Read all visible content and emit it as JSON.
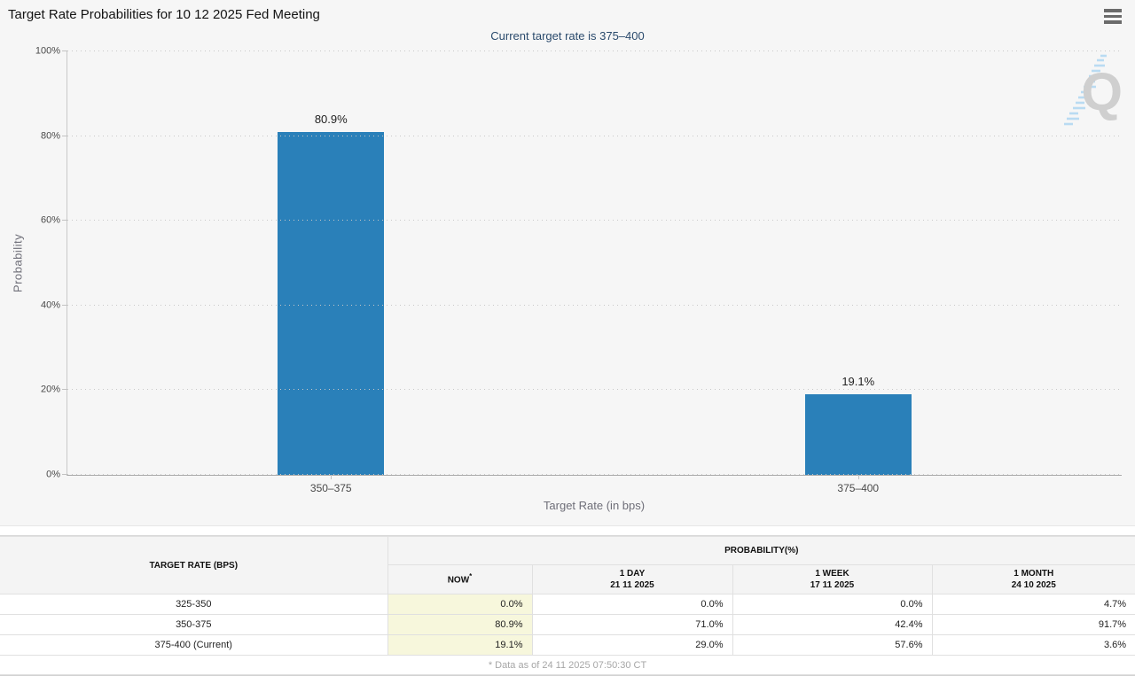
{
  "colors": {
    "bar": "#2a80b9",
    "chart_background": "#f6f6f6",
    "subtitle_text": "#2a4a6c",
    "now_column_background": "#f7f7dc"
  },
  "header": {
    "title": "Target Rate Probabilities for 10 12 2025 Fed Meeting"
  },
  "chart": {
    "subtitle": "Current target rate is 375–400",
    "y_axis_title": "Probability",
    "x_axis_title": "Target Rate (in bps)",
    "y_ticks": [
      "0%",
      "20%",
      "40%",
      "60%",
      "80%",
      "100%"
    ],
    "watermark_letter": "Q"
  },
  "chart_data": {
    "type": "bar",
    "title": "Target Rate Probabilities for 10 12 2025 Fed Meeting",
    "subtitle": "Current target rate is 375–400",
    "categories": [
      "350–375",
      "375–400"
    ],
    "values": [
      80.9,
      19.1
    ],
    "value_labels": [
      "80.9%",
      "19.1%"
    ],
    "xlabel": "Target Rate (in bps)",
    "ylabel": "Probability",
    "ylim": [
      0,
      100
    ],
    "y_tick_step": 20,
    "grid": "horizontal dotted",
    "legend": "none",
    "bar_color": "#2a80b9"
  },
  "table": {
    "col1_header": "TARGET RATE (BPS)",
    "group_header": "PROBABILITY(%)",
    "sub_headers": [
      {
        "line1": "NOW",
        "sup": "*",
        "line2": ""
      },
      {
        "line1": "1 DAY",
        "line2": "21 11 2025"
      },
      {
        "line1": "1 WEEK",
        "line2": "17 11 2025"
      },
      {
        "line1": "1 MONTH",
        "line2": "24 10 2025"
      }
    ],
    "rows": [
      {
        "target_rate": "325-350",
        "now": "0.0%",
        "day": "0.0%",
        "week": "0.0%",
        "month": "4.7%"
      },
      {
        "target_rate": "350-375",
        "now": "80.9%",
        "day": "71.0%",
        "week": "42.4%",
        "month": "91.7%"
      },
      {
        "target_rate": "375-400 (Current)",
        "now": "19.1%",
        "day": "29.0%",
        "week": "57.6%",
        "month": "3.6%"
      }
    ],
    "footnote": "* Data as of 24 11 2025 07:50:30 CT"
  }
}
